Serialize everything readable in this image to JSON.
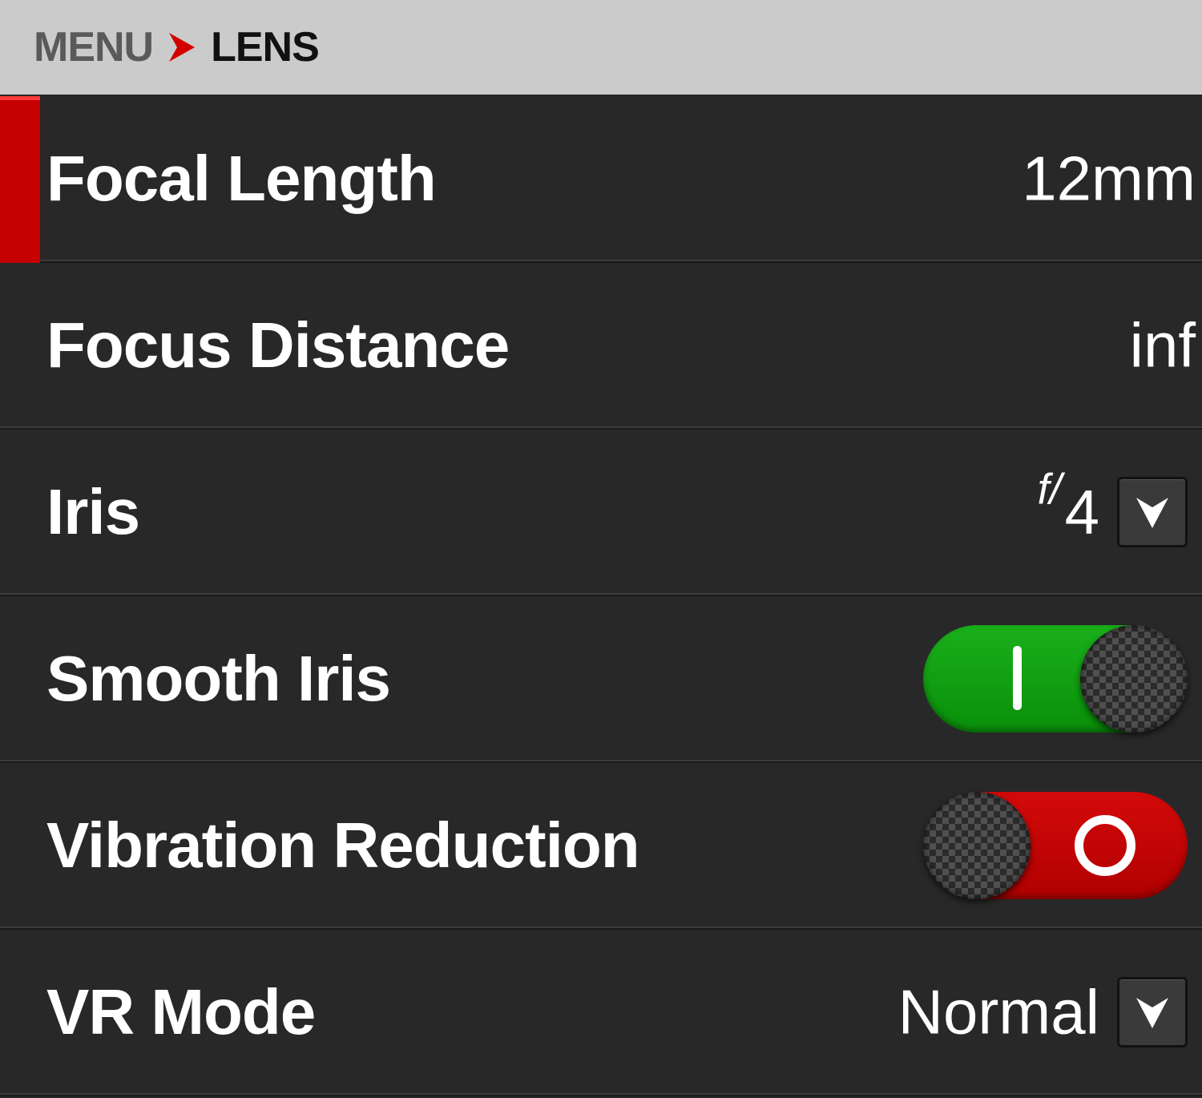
{
  "breadcrumb": {
    "parent": "MENU",
    "current": "LENS"
  },
  "colors": {
    "accent": "#c40000",
    "toggle_on": "#12a012",
    "toggle_off": "#c80000",
    "header_bg": "#cbcbcb",
    "row_bg": "#282828"
  },
  "rows": [
    {
      "label": "Focal Length",
      "value": "12mm",
      "selected": true
    },
    {
      "label": "Focus Distance",
      "value": "inf"
    },
    {
      "label": "Iris",
      "value_prefix": "f/",
      "value": "4",
      "control": "dropdown"
    },
    {
      "label": "Smooth Iris",
      "state": "on",
      "control": "toggle"
    },
    {
      "label": "Vibration Reduction",
      "state": "off",
      "control": "toggle"
    },
    {
      "label": "VR Mode",
      "value": "Normal",
      "control": "dropdown"
    }
  ],
  "icons": {
    "breadcrumb_separator": "chevron-right-icon",
    "dropdown": "chevron-down-icon"
  }
}
